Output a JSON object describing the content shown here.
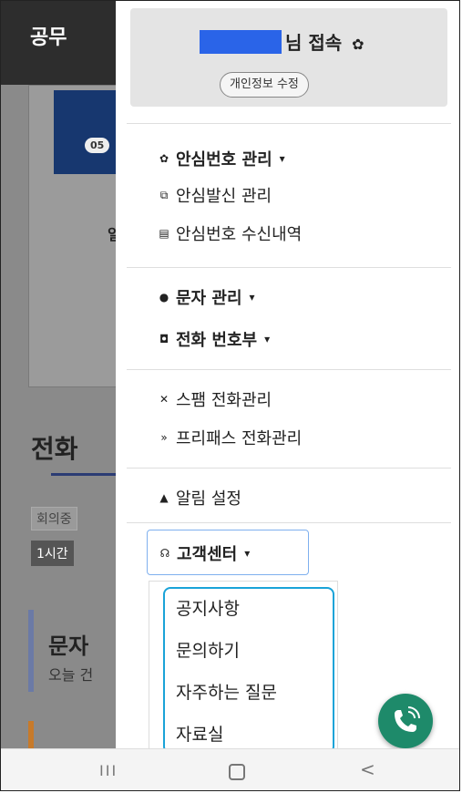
{
  "background": {
    "app_title": "공무",
    "badge": "05",
    "side_letter": "일",
    "heading": "전화",
    "chip_1": "회의중",
    "chip_2": "1시간",
    "section_title": "문자",
    "section_sub": "오늘 건"
  },
  "drawer": {
    "greeting": "님 접속",
    "edit_profile": "개인정보 수정",
    "menu": [
      {
        "label": "안심번호 관리",
        "caret": "▾"
      },
      {
        "label": "안심발신 관리"
      },
      {
        "label": "안심번호 수신내역"
      },
      {
        "label": "문자 관리",
        "caret": "▾"
      },
      {
        "label": "전화 번호부",
        "caret": "▾"
      },
      {
        "label": "스팸 전화관리"
      },
      {
        "label": "프리패스 전화관리"
      },
      {
        "label": "알림 설정"
      }
    ],
    "customer_center": {
      "label": "고객센터",
      "caret": "▾"
    },
    "submenu": [
      "공지사항",
      "문의하기",
      "자주하는 질문",
      "자료실"
    ]
  },
  "colors": {
    "accent": "#1aa3d8",
    "fab": "#1e8a6a",
    "name_block": "#2a64e8"
  },
  "navbar": {
    "recent": "III",
    "back": "<"
  }
}
